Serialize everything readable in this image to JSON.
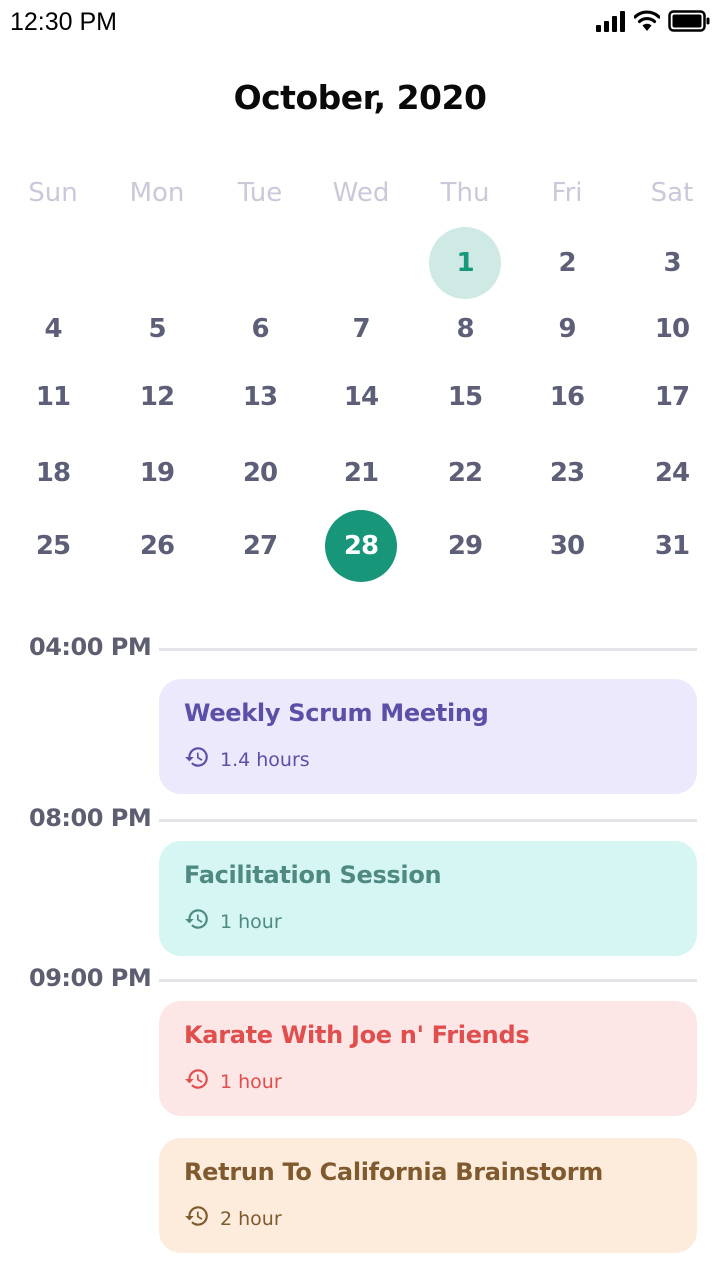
{
  "status_bar": {
    "time": "12:30 PM",
    "icons": [
      "signal-icon",
      "wifi-icon",
      "battery-icon"
    ]
  },
  "calendar": {
    "month_title": "October, 2020",
    "weekdays": [
      "Sun",
      "Mon",
      "Tue",
      "Wed",
      "Thu",
      "Fri",
      "Sat"
    ],
    "first_weekday_index": 4,
    "days_in_month": 31,
    "today": 1,
    "selected": 28,
    "colors": {
      "today_bg": "#cfe9e4",
      "today_text": "#17987a",
      "selected_bg": "#179679",
      "selected_text": "#ffffff",
      "day_text": "#5d5f78",
      "weekday_text": "#c9c9d9"
    }
  },
  "schedule": {
    "time_slots": [
      {
        "label": "04:00 PM"
      },
      {
        "label": "08:00 PM"
      },
      {
        "label": "09:00 PM"
      }
    ],
    "events": [
      {
        "title": "Weekly Scrum Meeting",
        "duration": "1.4 hours",
        "icon": "history-icon",
        "bg": "#ebe9fb",
        "fg": "#5c4fa8"
      },
      {
        "title": "Facilitation Session",
        "duration": "1 hour",
        "icon": "history-icon",
        "bg": "#d5f6f2",
        "fg": "#4e8a82"
      },
      {
        "title": "Karate With Joe n' Friends",
        "duration": "1 hour",
        "icon": "history-icon",
        "bg": "#fde6e6",
        "fg": "#e04e4e"
      },
      {
        "title": "Retrun To California Brainstorm",
        "duration": "2 hour",
        "icon": "history-icon",
        "bg": "#fdebdc",
        "fg": "#7f5a2e"
      }
    ]
  }
}
